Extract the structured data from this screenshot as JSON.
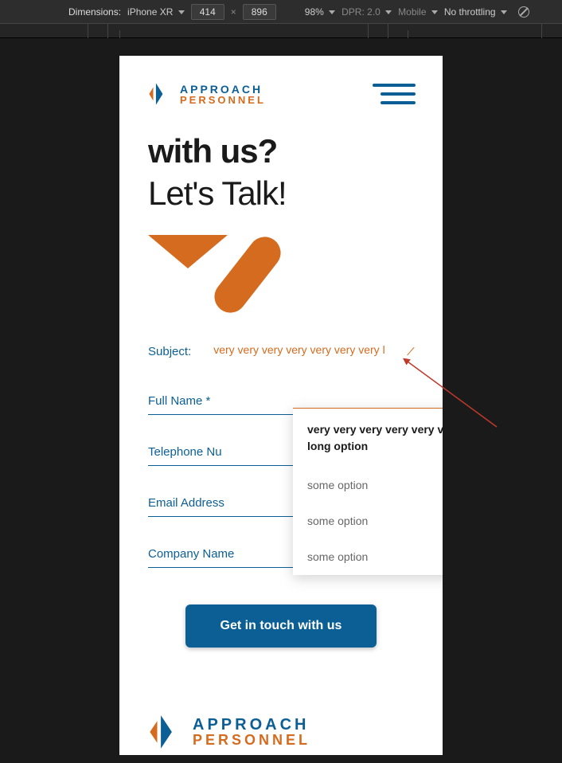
{
  "devtools": {
    "dimensions_label": "Dimensions:",
    "device": "iPhone XR",
    "width": "414",
    "height": "896",
    "zoom": "98%",
    "dpr": "DPR: 2.0",
    "device_type": "Mobile",
    "throttling": "No throttling"
  },
  "brand": {
    "name_top": "APPROACH",
    "name_bottom": "PERSONNEL"
  },
  "hero": {
    "line1": "with us?",
    "line2": "Let's Talk!"
  },
  "form": {
    "subject_label": "Subject:",
    "subject_value": "very very very very very very very long option",
    "fields": {
      "full_name": "Full Name *",
      "telephone": "Telephone Nu",
      "email": "Email Address",
      "company": "Company Name"
    },
    "submit_label": "Get in touch with us"
  },
  "dropdown": {
    "options": [
      "very very very very very very very long option",
      "some option",
      "some option",
      "some option"
    ]
  },
  "colors": {
    "brand_blue": "#0b5f94",
    "brand_orange": "#d56b1e"
  }
}
